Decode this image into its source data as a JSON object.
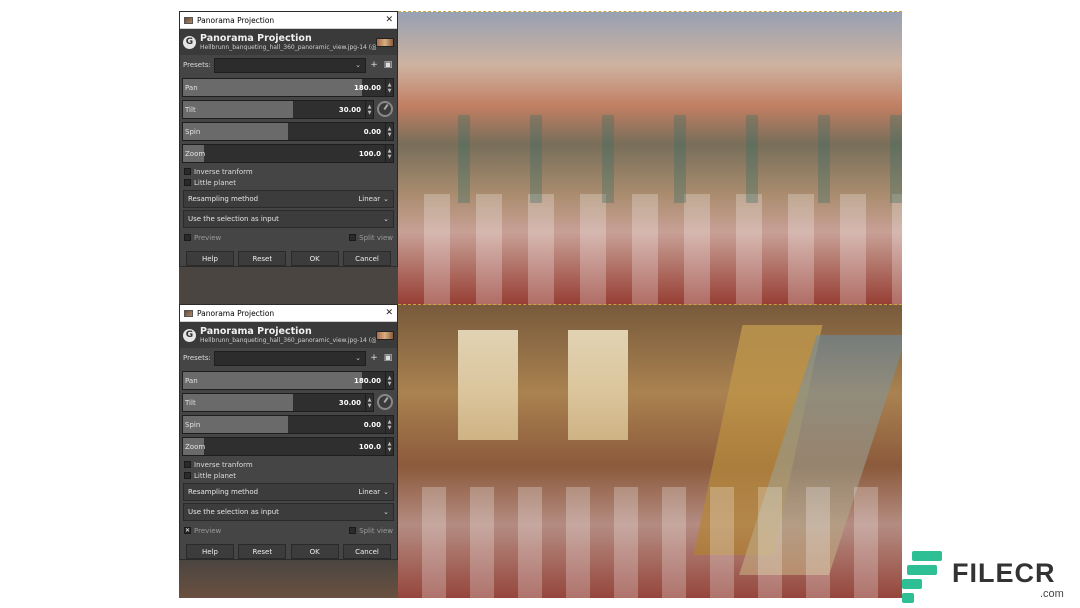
{
  "dialog": {
    "window_title": "Panorama Projection",
    "plugin_name": "Panorama Projection",
    "image_name": "Hellbrunn_banqueting_hall_360_panoramic_view.jpg-14 (@He...",
    "presets_label": "Presets:",
    "sliders": [
      {
        "label": "Pan",
        "value": "180.00",
        "fill": 0.85
      },
      {
        "label": "Tilt",
        "value": "30.00",
        "fill": 0.58
      },
      {
        "label": "Spin",
        "value": "0.00",
        "fill": 0.5
      },
      {
        "label": "Zoom",
        "value": "100.0",
        "fill": 0.1
      }
    ],
    "inverse_transform": "Inverse tranform",
    "little_planet": "Little planet",
    "resampling_label": "Resampling method",
    "resampling_value": "Linear",
    "selection_label": "Use the selection as input",
    "preview_label": "Preview",
    "split_view_label": "Split view",
    "buttons": {
      "help": "Help",
      "reset": "Reset",
      "ok": "OK",
      "cancel": "Cancel"
    }
  },
  "panels": {
    "top_preview_checked": false,
    "bottom_preview_checked": true
  },
  "watermark": {
    "brand": "FILECR",
    "domain": ".com"
  },
  "colors": {
    "accent": "#2fbf95",
    "dialog_bg": "#454545"
  }
}
